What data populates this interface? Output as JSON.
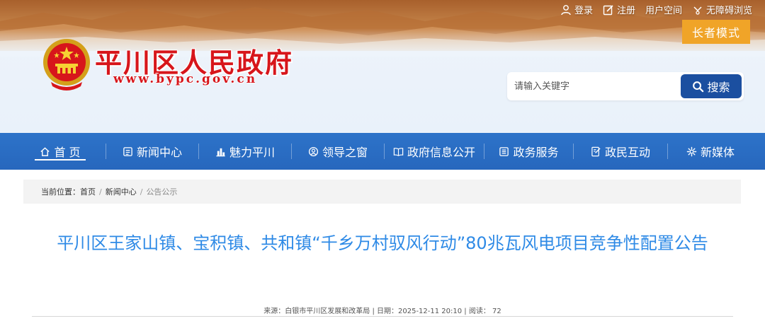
{
  "header": {
    "site_title": "平川区人民政府",
    "site_url": "www.bypc.gov.cn",
    "elder_mode": "长者模式",
    "toplinks": {
      "login": "登录",
      "register": "注册",
      "user_space": "用户空间",
      "accessible": "无障碍浏览"
    },
    "search": {
      "placeholder": "请输入关键字",
      "button": "搜索"
    }
  },
  "nav": {
    "items": [
      {
        "label": "首 页",
        "icon": "home-icon"
      },
      {
        "label": "新闻中心",
        "icon": "newspaper-icon"
      },
      {
        "label": "魅力平川",
        "icon": "city-icon"
      },
      {
        "label": "领导之窗",
        "icon": "person-icon"
      },
      {
        "label": "政府信息公开",
        "icon": "book-icon"
      },
      {
        "label": "政务服务",
        "icon": "list-icon"
      },
      {
        "label": "政民互动",
        "icon": "edit-icon"
      },
      {
        "label": "新媒体",
        "icon": "gear-icon"
      }
    ],
    "active_index": 0
  },
  "breadcrumb": {
    "prefix": "当前位置：",
    "items": [
      "首页",
      "新闻中心",
      "公告公示"
    ]
  },
  "article": {
    "title": "平川区王家山镇、宝积镇、共和镇“千乡万村驭风行动”80兆瓦风电项目竞争性配置公告",
    "meta": "来源：白银市平川区发展和改革局 | 日期：2025-12-11 20:10 | 阅读：  72"
  },
  "colors": {
    "title_red": "#d7161b",
    "nav_blue": "#2767bd",
    "search_blue": "#1b4fa0",
    "elder_orange": "#f0a428",
    "article_title_blue": "#2e8ae6"
  }
}
